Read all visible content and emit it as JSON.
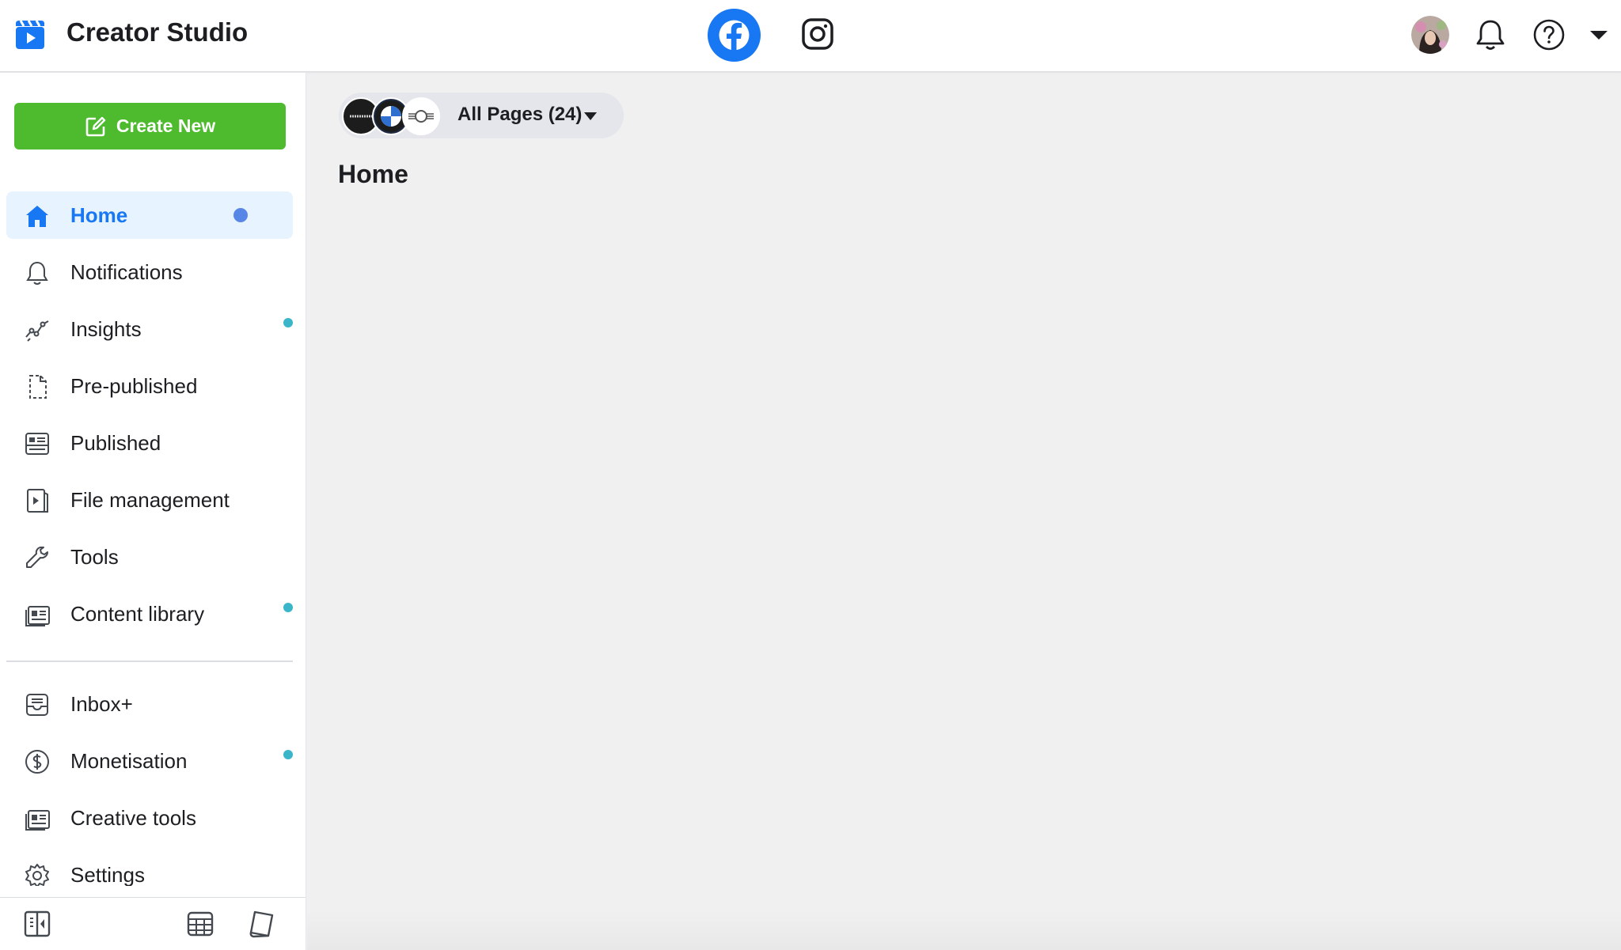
{
  "app": {
    "title": "Creator Studio"
  },
  "topbar": {
    "platforms": [
      {
        "name": "facebook-icon",
        "active": true
      },
      {
        "name": "instagram-icon",
        "active": false
      }
    ],
    "accent_color": "#1877f2"
  },
  "sidebar": {
    "create_label": "Create New",
    "create_color": "#4ebb2f",
    "items": [
      {
        "label": "Home",
        "icon": "home-icon",
        "active": true,
        "badge": "blue-dot"
      },
      {
        "label": "Notifications",
        "icon": "bell-icon"
      },
      {
        "label": "Insights",
        "icon": "insights-icon",
        "badge": "teal-dot"
      },
      {
        "label": "Pre-published",
        "icon": "draft-document-icon"
      },
      {
        "label": "Published",
        "icon": "published-icon"
      },
      {
        "label": "File management",
        "icon": "file-video-icon"
      },
      {
        "label": "Tools",
        "icon": "wrench-icon"
      },
      {
        "label": "Content library",
        "icon": "content-library-icon",
        "badge": "teal-dot"
      },
      {
        "label": "Inbox+",
        "icon": "inbox-icon"
      },
      {
        "label": "Monetisation",
        "icon": "dollar-circle-icon",
        "badge": "teal-dot"
      },
      {
        "label": "Creative tools",
        "icon": "creative-tools-icon"
      },
      {
        "label": "Settings",
        "icon": "gear-icon"
      }
    ],
    "bottom_icons": [
      "collapse-sidebar-icon",
      "table-icon",
      "book-icon"
    ]
  },
  "main": {
    "page_selector": {
      "label": "All Pages (24)",
      "avatars": [
        "brickworks-avatar",
        "bmw-avatar",
        "mini-avatar"
      ]
    },
    "title": "Home"
  }
}
